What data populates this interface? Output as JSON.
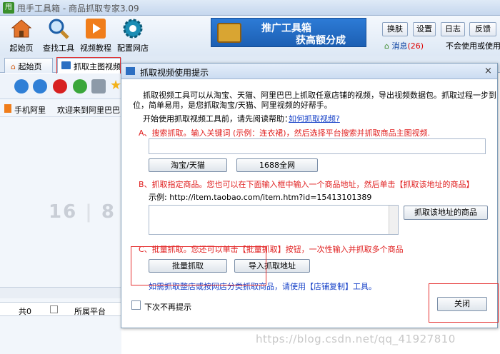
{
  "window": {
    "title": "甩手工具箱 - 商品抓取专家3.09",
    "logo": "甩"
  },
  "toolbar": {
    "buttons": [
      {
        "label": "起始页",
        "icon": "home-icon"
      },
      {
        "label": "查找工具",
        "icon": "magnifier-icon"
      },
      {
        "label": "视频教程",
        "icon": "play-icon"
      },
      {
        "label": "配置网店",
        "icon": "gear-icon"
      }
    ],
    "banner": {
      "line1": "推广工具箱",
      "line2": "获高额分成"
    },
    "small_buttons": [
      "换肤",
      "设置",
      "日志",
      "反馈"
    ],
    "message_label": "消息",
    "message_count": "(26)",
    "note": "不会使用或使用"
  },
  "tabs": [
    {
      "label": "起始页"
    },
    {
      "label": "抓取主图视频"
    }
  ],
  "left_panel": {
    "shop_label": "手机阿里",
    "welcome": "欢迎来到阿里巴巴",
    "date_left": "16",
    "date_right": "8",
    "count": "共0",
    "platform_header": "所属平台"
  },
  "dialog": {
    "title": "抓取视频使用提示",
    "close_glyph": "×",
    "intro_line1": "抓取视频工具可以从淘宝、天猫、阿里巴巴上抓取任意店铺的视频，导出视频数据包。抓取过程一步到",
    "intro_line2": "位，简单易用，是您抓取淘宝/天猫、阿里视频的好帮手。",
    "help_prefix": "开始使用抓取视频工具前，请先阅读帮助：",
    "help_link": "如何抓取视频?",
    "section_a": "A、搜索抓取。输入关键词 (示例：连衣裙)，然后选择平台搜索并抓取商品主图视频.",
    "search_value": "",
    "btn_taobao": "淘宝/天猫",
    "btn_1688": "1688全网",
    "section_b": "B、抓取指定商品。您也可以在下面输入框中输入一个商品地址，然后单击【抓取该地址的商品】",
    "example": "示例: http://item.taobao.com/item.htm?id=15413101389",
    "url_value": "",
    "btn_fetch_url": "抓取该地址的商品",
    "section_c": "C、批量抓取。您还可以单击【批量抓取】按钮，一次性输入并抓取多个商品",
    "btn_batch": "批量抓取",
    "btn_import": "导入抓取地址",
    "shop_note": "如需抓取整店或按网店分类抓取商品，请使用【店铺复制】工具。",
    "no_show_label": "下次不再提示",
    "btn_close": "关闭"
  },
  "watermark": "https://blog.csdn.net/qq_41927810"
}
